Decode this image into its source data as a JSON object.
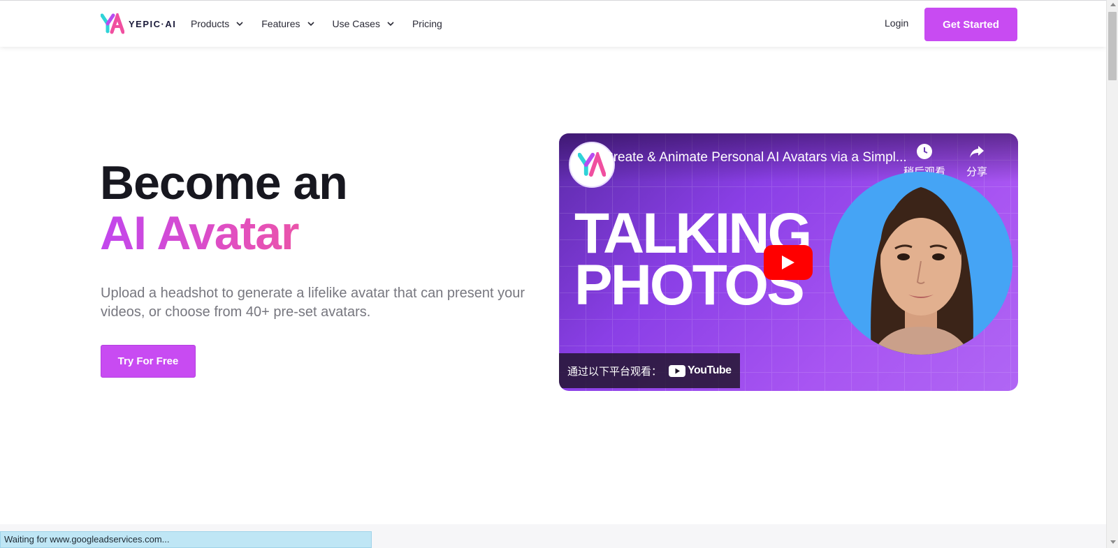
{
  "header": {
    "logo_text": "YEPIC·AI",
    "nav": [
      {
        "label": "Products",
        "has_dropdown": true
      },
      {
        "label": "Features",
        "has_dropdown": true
      },
      {
        "label": "Use Cases",
        "has_dropdown": true
      },
      {
        "label": "Pricing",
        "has_dropdown": false
      }
    ],
    "login_label": "Login",
    "cta_label": "Get Started"
  },
  "hero": {
    "title_line1": "Become an",
    "title_line2": "AI Avatar",
    "subtitle": "Upload a headshot to generate a lifelike avatar that can present your videos, or choose from 40+ pre-set avatars.",
    "cta_label": "Try For Free"
  },
  "video": {
    "title": "Create & Animate Personal AI Avatars via a Simpl...",
    "watch_later_label": "稍后观看",
    "share_label": "分享",
    "thumbnail_text_line1": "TALKING",
    "thumbnail_text_line2": "PHOTOS",
    "watch_on_label": "通过以下平台观看：",
    "platform_label": "YouTube"
  },
  "browser": {
    "status_text": "Waiting for www.googleadservices.com..."
  },
  "colors": {
    "brand_purple": "#c84bf2",
    "gradient_start": "#c146ee",
    "gradient_end": "#f0579a",
    "youtube_red": "#ff0000"
  }
}
